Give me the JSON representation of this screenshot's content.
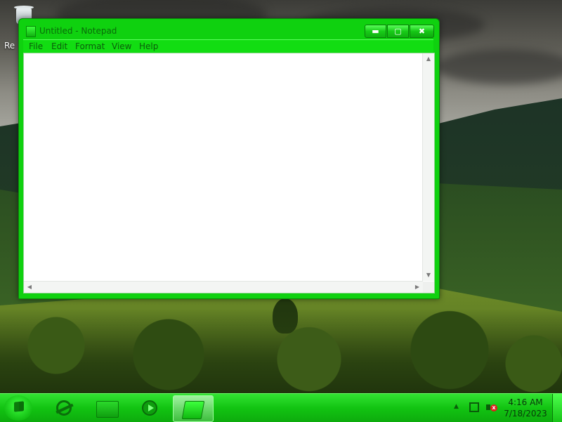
{
  "desktop": {
    "icons": [
      {
        "name": "recycle-bin",
        "label": "Re"
      }
    ]
  },
  "window": {
    "title": "Untitled - Notepad",
    "menu": [
      "File",
      "Edit",
      "Format",
      "View",
      "Help"
    ],
    "controls": {
      "minimize_icon": "minimize-icon",
      "maximize_icon": "maximize-icon",
      "close_icon": "close-icon"
    },
    "editor": {
      "content": ""
    }
  },
  "taskbar": {
    "pinned": [
      {
        "name": "start-button",
        "icon": "windows-logo-icon"
      },
      {
        "name": "internet-explorer",
        "icon": "internet-explorer-icon"
      },
      {
        "name": "file-explorer",
        "icon": "folder-icon"
      },
      {
        "name": "media-player",
        "icon": "media-player-icon"
      },
      {
        "name": "notepad",
        "icon": "notepad-icon",
        "active": true
      }
    ],
    "tray": {
      "icons": [
        "show-hidden-icons-icon",
        "network-icon",
        "volume-muted-icon"
      ],
      "time": "4:16 AM",
      "date": "7/18/2023"
    }
  },
  "theme": {
    "accent": "#12cc12",
    "titlebar_text": "#0a6b0a",
    "close_badge": "#e01f1f"
  }
}
